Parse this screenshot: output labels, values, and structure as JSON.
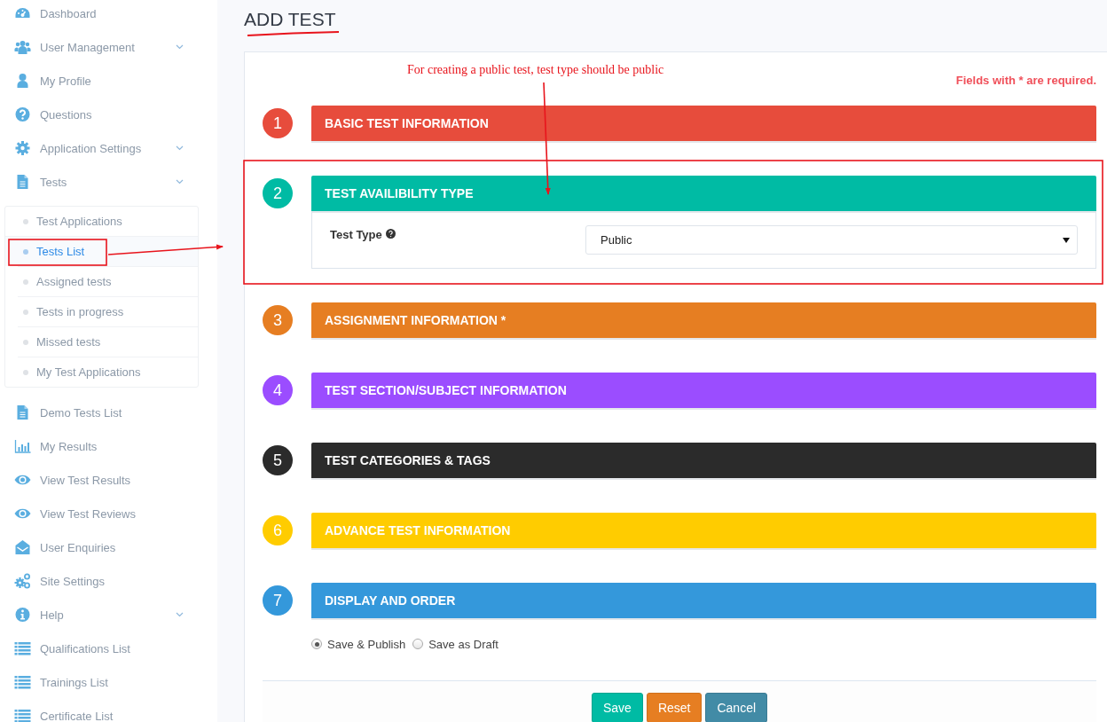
{
  "sidebar": {
    "items": [
      {
        "label": "Dashboard",
        "dropdown": false
      },
      {
        "label": "User Management",
        "dropdown": true
      },
      {
        "label": "My Profile",
        "dropdown": false
      },
      {
        "label": "Questions",
        "dropdown": false
      },
      {
        "label": "Application Settings",
        "dropdown": true
      },
      {
        "label": "Tests",
        "dropdown": true,
        "expanded": true,
        "children": [
          {
            "label": "Test Applications",
            "selected": false
          },
          {
            "label": "Tests List",
            "selected": true
          },
          {
            "label": "Assigned tests",
            "selected": false
          },
          {
            "label": "Tests in progress",
            "selected": false
          },
          {
            "label": "Missed tests",
            "selected": false
          },
          {
            "label": "My Test Applications",
            "selected": false
          }
        ]
      },
      {
        "label": "Demo Tests List",
        "dropdown": false
      },
      {
        "label": "My Results",
        "dropdown": false
      },
      {
        "label": "View Test Results",
        "dropdown": false
      },
      {
        "label": "View Test Reviews",
        "dropdown": false
      },
      {
        "label": "User Enquiries",
        "dropdown": false
      },
      {
        "label": "Site Settings",
        "dropdown": false
      },
      {
        "label": "Help",
        "dropdown": true
      },
      {
        "label": "Qualifications List",
        "dropdown": false
      },
      {
        "label": "Trainings List",
        "dropdown": false
      },
      {
        "label": "Certificate List",
        "dropdown": false
      }
    ]
  },
  "page_title": "ADD TEST",
  "annotation": {
    "note": "For creating a public test, test type should be public"
  },
  "required_note": "Fields with * are required.",
  "steps": [
    {
      "number": "1",
      "title": "BASIC TEST INFORMATION",
      "color": "#e74c3c"
    },
    {
      "number": "2",
      "title": "TEST AVAILIBILITY TYPE",
      "color": "#00bba4",
      "kind": "select",
      "field": {
        "label": "Test Type",
        "value": "Public"
      }
    },
    {
      "number": "3",
      "title": "ASSIGNMENT INFORMATION *",
      "color": "#e67e22"
    },
    {
      "number": "4",
      "title": "TEST SECTION/SUBJECT INFORMATION",
      "color": "#9b4dff"
    },
    {
      "number": "5",
      "title": "TEST CATEGORIES & TAGS",
      "color": "#2b2b2b"
    },
    {
      "number": "6",
      "title": "ADVANCE TEST INFORMATION",
      "color": "#ffcc00"
    },
    {
      "number": "7",
      "title": "DISPLAY AND ORDER",
      "color": "#3498db",
      "kind": "radios",
      "options": [
        {
          "label": "Save & Publish",
          "selected": true
        },
        {
          "label": "Save as Draft",
          "selected": false
        }
      ]
    }
  ],
  "buttons": [
    {
      "label": "Save",
      "kind": "primary"
    },
    {
      "label": "Reset",
      "kind": "warning"
    },
    {
      "label": "Cancel",
      "kind": "info"
    }
  ]
}
